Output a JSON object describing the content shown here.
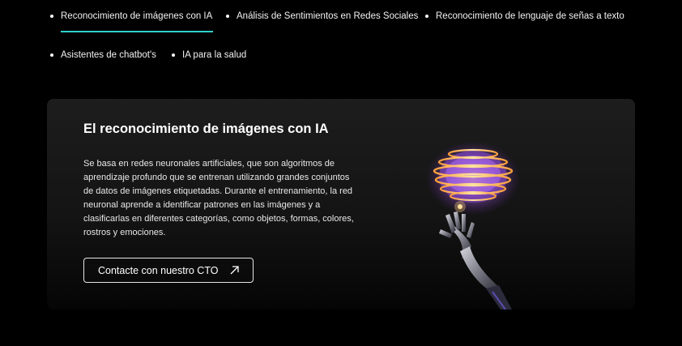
{
  "tabs": [
    {
      "label": "Reconocimiento de imágenes con IA",
      "active": true
    },
    {
      "label": "Análisis de Sentimientos en Redes Sociales",
      "active": false
    },
    {
      "label": "Reconocimiento de lenguaje de señas a texto",
      "active": false
    },
    {
      "label": "Asistentes de chatbot's",
      "active": false
    },
    {
      "label": "IA para la salud",
      "active": false
    }
  ],
  "card": {
    "title": "El reconocimiento de imágenes con IA",
    "description": "Se basa en redes neuronales artificiales, que son algoritmos de aprendizaje profundo que se entrenan utilizando grandes conjuntos de datos de imágenes etiquetadas. Durante el entrenamiento, la red neuronal aprende a identificar patrones en las imágenes y a clasificarlas en diferentes categorías, como objetos, formas, colores, rostros y emociones.",
    "cta_label": "Contacte con nuestro CTO",
    "cta_icon": "arrow-up-right-icon",
    "illustration": "robot-hand-brain-illustration"
  },
  "colors": {
    "background": "#000000",
    "accent": "#2fd1c8",
    "card": "#1a1a1a"
  }
}
